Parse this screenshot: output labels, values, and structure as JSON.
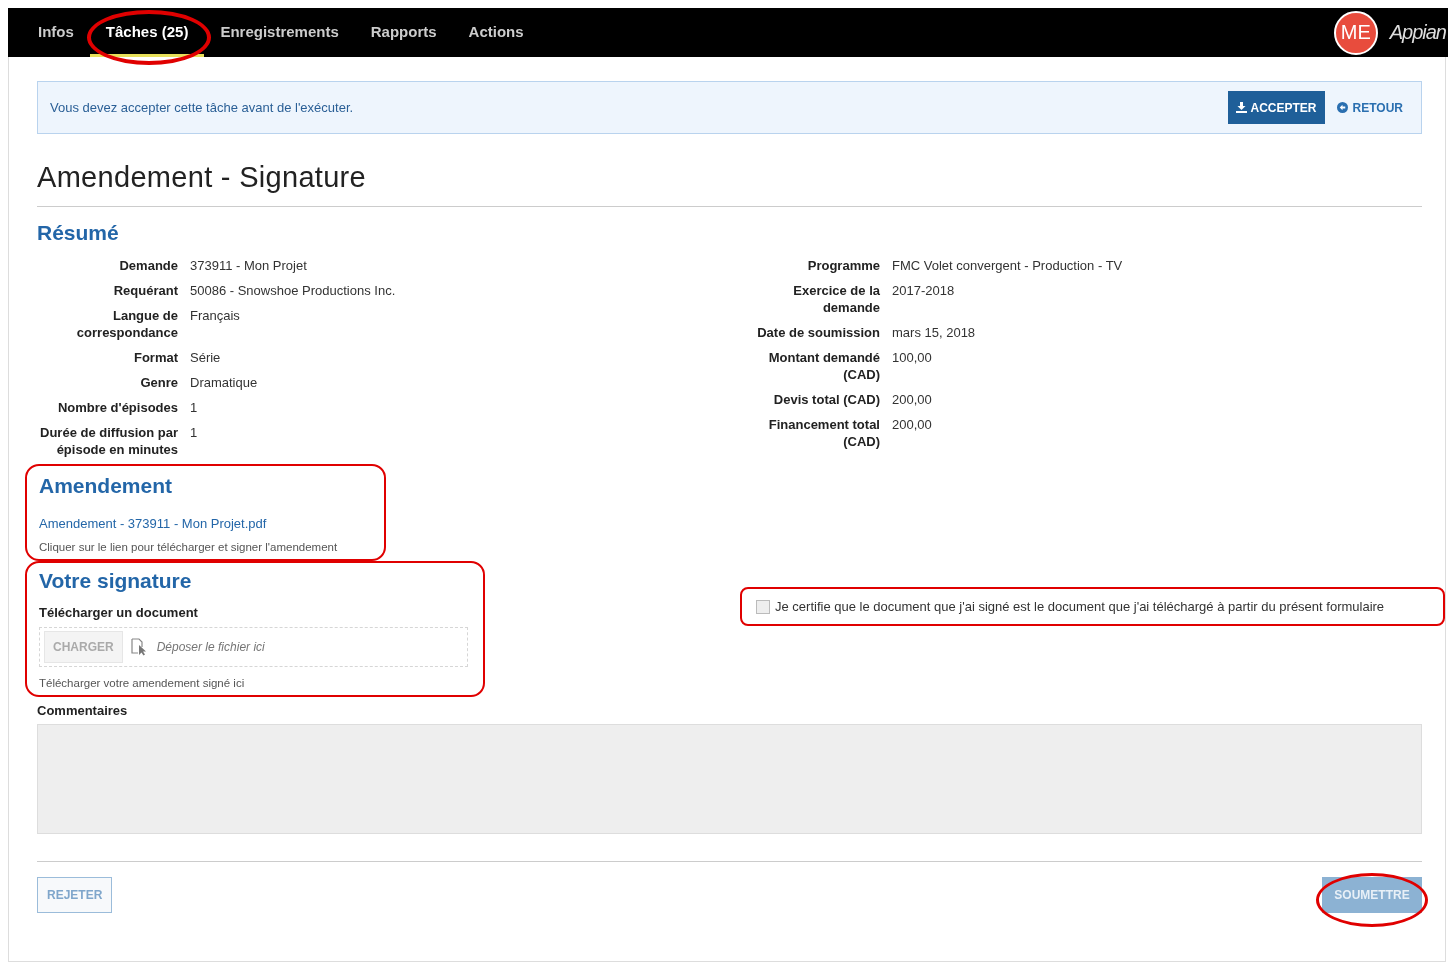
{
  "nav": {
    "tabs": [
      {
        "label": "Infos",
        "selected": false,
        "highlighted": false
      },
      {
        "label": "Tâches (25)",
        "selected": true,
        "highlighted": true
      },
      {
        "label": "Enregistrements",
        "selected": false,
        "highlighted": false
      },
      {
        "label": "Rapports",
        "selected": false,
        "highlighted": false
      },
      {
        "label": "Actions",
        "selected": false,
        "highlighted": false
      }
    ],
    "avatar": "ME",
    "brand": "Appian"
  },
  "banner": {
    "message": "Vous devez accepter cette tâche avant de l'exécuter.",
    "accept": "ACCEPTER",
    "back": "RETOUR"
  },
  "title": "Amendement - Signature",
  "summary": {
    "heading": "Résumé",
    "left": [
      {
        "label": "Demande",
        "value": "373911 - Mon Projet"
      },
      {
        "label": "Requérant",
        "value": "50086 - Snowshoe Productions Inc."
      },
      {
        "label": "Langue de correspondance",
        "value": "Français"
      },
      {
        "label": "Format",
        "value": "Série"
      },
      {
        "label": "Genre",
        "value": "Dramatique"
      },
      {
        "label": "Nombre d'épisodes",
        "value": "1"
      },
      {
        "label": "Durée de diffusion par épisode en minutes",
        "value": "1"
      }
    ],
    "right": [
      {
        "label": "Programme",
        "value": "FMC Volet convergent - Production - TV"
      },
      {
        "label": "Exercice de la demande",
        "value": "2017-2018"
      },
      {
        "label": "Date de soumission",
        "value": "mars 15, 2018"
      },
      {
        "label": "Montant demandé (CAD)",
        "value": "100,00"
      },
      {
        "label": "Devis total (CAD)",
        "value": "200,00"
      },
      {
        "label": "Financement total (CAD)",
        "value": "200,00"
      }
    ]
  },
  "amendment": {
    "heading": "Amendement",
    "link": "Amendement - 373911 - Mon Projet.pdf",
    "help": "Cliquer sur le lien pour télécharger et signer l'amendement",
    "highlighted": true
  },
  "signature": {
    "heading": "Votre signature",
    "label": "Télécharger un document",
    "upload_button": "CHARGER",
    "placeholder": "Déposer le fichier ici",
    "help": "Télécharger votre amendement signé ici",
    "highlighted": true
  },
  "certification": {
    "label": "Je certifie que le document que j'ai signé est le document que j'ai téléchargé à partir du présent formulaire",
    "checked": false,
    "highlighted": true
  },
  "comments": {
    "label": "Commentaires"
  },
  "footer": {
    "reject": "REJETER",
    "submit": {
      "label": "SOUMETTRE",
      "disabled": true,
      "highlighted": true
    }
  }
}
